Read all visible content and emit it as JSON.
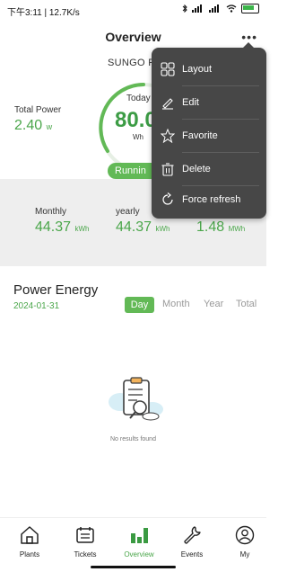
{
  "status_bar": {
    "time_and_speed": "下午3:11 | 12.7K/s",
    "battery_color": "#3cb54a"
  },
  "header": {
    "title": "Overview",
    "more_icon": "more-dots-icon"
  },
  "plant": {
    "name": "SUNGO P"
  },
  "total_power": {
    "label": "Total Power",
    "value": "2.40",
    "unit": "w"
  },
  "today": {
    "label": "Today",
    "value": "80.0",
    "unit": "Wh",
    "status": "Runnin"
  },
  "stats": [
    {
      "label": "Monthly",
      "value": "44.37",
      "unit": "kWh"
    },
    {
      "label": "yearly",
      "value": "44.37",
      "unit": "kWh"
    },
    {
      "label": "",
      "value": "1.48",
      "unit": "MWh"
    }
  ],
  "power_energy": {
    "title": "Power Energy",
    "date": "2024-01-31",
    "tabs": [
      "Day",
      "Month",
      "Year",
      "Total"
    ],
    "active_tab": "Day",
    "empty_text": "No results found"
  },
  "menu": {
    "items": [
      {
        "label": "Layout",
        "icon": "grid-layout-icon"
      },
      {
        "label": "Edit",
        "icon": "pencil-icon"
      },
      {
        "label": "Favorite",
        "icon": "star-icon"
      },
      {
        "label": "Delete",
        "icon": "trash-icon"
      },
      {
        "label": "Force refresh",
        "icon": "refresh-icon"
      }
    ]
  },
  "bottom_nav": {
    "items": [
      {
        "label": "Plants",
        "icon": "home-icon"
      },
      {
        "label": "Tickets",
        "icon": "ticket-icon"
      },
      {
        "label": "Overview",
        "icon": "bar-chart-icon"
      },
      {
        "label": "Events",
        "icon": "wrench-icon"
      },
      {
        "label": "My",
        "icon": "user-icon"
      }
    ],
    "active": "Overview"
  },
  "colors": {
    "accent": "#4aa64a",
    "badge": "#62b956",
    "menu_bg": "#474747",
    "band_bg": "#eeeeee"
  }
}
